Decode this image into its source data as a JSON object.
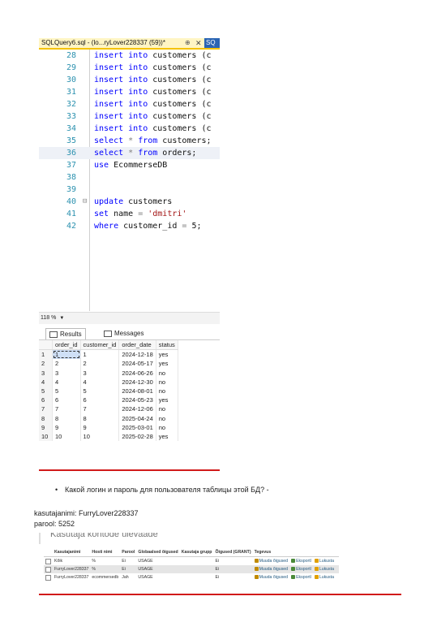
{
  "ssms": {
    "tab_title": "SQLQuery6.sql - (lo...ryLover228337 (59))*",
    "tab_pin": "⊕",
    "tab_close": "✕",
    "tab_next": "SQ",
    "lines": [
      {
        "num": "28",
        "code": [
          {
            "t": "insert into",
            "c": "k"
          },
          {
            "t": " customers (c",
            "c": ""
          }
        ]
      },
      {
        "num": "29",
        "code": [
          {
            "t": "insert into",
            "c": "k"
          },
          {
            "t": " customers (c",
            "c": ""
          }
        ]
      },
      {
        "num": "30",
        "code": [
          {
            "t": "insert into",
            "c": "k"
          },
          {
            "t": " customers (c",
            "c": ""
          }
        ]
      },
      {
        "num": "31",
        "code": [
          {
            "t": "insert into",
            "c": "k"
          },
          {
            "t": " customers (c",
            "c": ""
          }
        ]
      },
      {
        "num": "32",
        "code": [
          {
            "t": "insert into",
            "c": "k"
          },
          {
            "t": " customers (c",
            "c": ""
          }
        ]
      },
      {
        "num": "33",
        "code": [
          {
            "t": "insert into",
            "c": "k"
          },
          {
            "t": " customers (c",
            "c": ""
          }
        ]
      },
      {
        "num": "34",
        "code": [
          {
            "t": "insert into",
            "c": "k"
          },
          {
            "t": " customers (c",
            "c": ""
          }
        ]
      },
      {
        "num": "35",
        "code": [
          {
            "t": "select",
            "c": "k"
          },
          {
            "t": " * ",
            "c": "g"
          },
          {
            "t": "from",
            "c": "k"
          },
          {
            "t": " customers;",
            "c": ""
          }
        ]
      },
      {
        "num": "36",
        "code": [
          {
            "t": "select",
            "c": "k"
          },
          {
            "t": " * ",
            "c": "g"
          },
          {
            "t": "from",
            "c": "k"
          },
          {
            "t": " orders;",
            "c": ""
          }
        ],
        "hl": true
      },
      {
        "num": "37",
        "code": [
          {
            "t": "use",
            "c": "k"
          },
          {
            "t": " EcommerseDB",
            "c": ""
          }
        ]
      },
      {
        "num": "38",
        "code": []
      },
      {
        "num": "39",
        "code": []
      },
      {
        "num": "40",
        "code": [
          {
            "t": "update",
            "c": "k"
          },
          {
            "t": " customers",
            "c": ""
          }
        ],
        "fold": "⊟"
      },
      {
        "num": "41",
        "code": [
          {
            "t": "set",
            "c": "k"
          },
          {
            "t": " name ",
            "c": ""
          },
          {
            "t": "=",
            "c": "g"
          },
          {
            "t": " 'dmitri'",
            "c": "s"
          }
        ]
      },
      {
        "num": "42",
        "code": [
          {
            "t": "where",
            "c": "k"
          },
          {
            "t": " customer_id ",
            "c": ""
          },
          {
            "t": "=",
            "c": "g"
          },
          {
            "t": " 5;",
            "c": ""
          }
        ]
      }
    ],
    "zoom": "118 %",
    "tabs": {
      "results": "Results",
      "messages": "Messages"
    },
    "columns": [
      "order_id",
      "customer_id",
      "order_date",
      "status"
    ],
    "rows": [
      [
        "1",
        "1",
        "1",
        "2024-12-18",
        "yes"
      ],
      [
        "2",
        "2",
        "2",
        "2024-05-17",
        "yes"
      ],
      [
        "3",
        "3",
        "3",
        "2024-06-26",
        "no"
      ],
      [
        "4",
        "4",
        "4",
        "2024-12-30",
        "no"
      ],
      [
        "5",
        "5",
        "5",
        "2024-08-01",
        "no"
      ],
      [
        "6",
        "6",
        "6",
        "2024-05-23",
        "yes"
      ],
      [
        "7",
        "7",
        "7",
        "2024-12-06",
        "no"
      ],
      [
        "8",
        "8",
        "8",
        "2025-04-24",
        "no"
      ],
      [
        "9",
        "9",
        "9",
        "2025-03-01",
        "no"
      ],
      [
        "10",
        "10",
        "10",
        "2025-02-28",
        "yes"
      ]
    ]
  },
  "question": "Какой логин и пароль для пользователя таблицы этой БД? -",
  "credentials": {
    "username_line": "kasutajanimi: FurryLover228337",
    "password_line": "parool: 5252"
  },
  "pma": {
    "title": "Kasutaja kontode ülevaade",
    "headers": [
      "Kasutajanimi",
      "Hosti nimi",
      "Parool",
      "Globaalsed õigused",
      "Kasutaja grupp",
      "Õigused (GRANT)",
      "Tegevus"
    ],
    "rows": [
      {
        "user": "Kõik",
        "host": "%",
        "password": "Ei",
        "global": "USAGE",
        "group": "",
        "grant": "Ei",
        "user_red": true
      },
      {
        "user": "FurryLover228337",
        "host": "%",
        "password": "Ei",
        "global": "USAGE",
        "group": "",
        "grant": "Ei",
        "user_red": false
      },
      {
        "user": "FurryLover228337",
        "host": "ecommersedb",
        "password": "Jah",
        "global": "USAGE",
        "group": "",
        "grant": "Ei",
        "user_red": false
      }
    ],
    "actions": {
      "edit": "Muuda õigused",
      "export": "Eksportl",
      "lock": "Lukusta"
    },
    "colors": {
      "accent_red": "#d11a1a",
      "link_blue": "#235a81",
      "tab_yellow": "#fff5c4"
    }
  }
}
